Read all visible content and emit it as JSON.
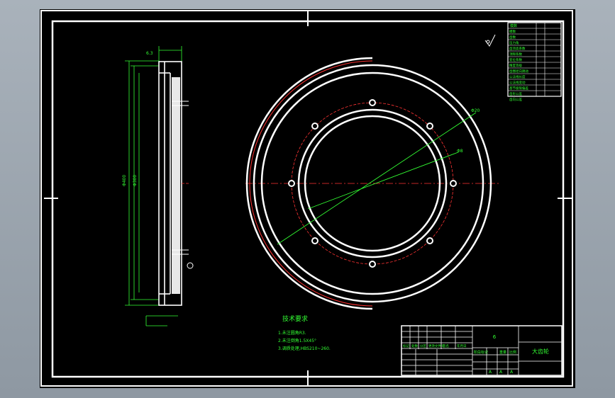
{
  "drawing": {
    "title_block": {
      "part_name": "大齿轮",
      "material_mark": "6",
      "scale_labels": [
        "阶段标记",
        "重量",
        "比例"
      ],
      "sheet_letters": [
        "A",
        "A",
        "A"
      ],
      "row_labels": [
        "标记",
        "处数",
        "分区",
        "更改文件号",
        "签名",
        "年月日"
      ]
    },
    "parameter_table": {
      "title": "模数",
      "rows": [
        "模数",
        "齿数",
        "压力角",
        "齿顶高系数",
        "顶隙系数",
        "变位系数",
        "精度等级",
        "齿圈径向跳动",
        "公法线长度",
        "公法线变动",
        "基节极限偏差",
        "齿形公差",
        "齿向公差"
      ]
    },
    "tech_requirements": {
      "heading": "技术要求",
      "items": [
        "1.未注圆角R3.",
        "2.未注倒角1.5X45°",
        "3.调质处理,HBS210~260."
      ]
    },
    "dimension_labels": {
      "left_top": "6.3",
      "diam_outer": "Φ400",
      "diam_bore": "Φ300",
      "leader1": "Φ20",
      "leader2": "Φ8"
    }
  },
  "colors": {
    "background": "#000000",
    "frame": "#ffffff",
    "dimension": "#33ff33",
    "centerline": "#ff3333"
  }
}
